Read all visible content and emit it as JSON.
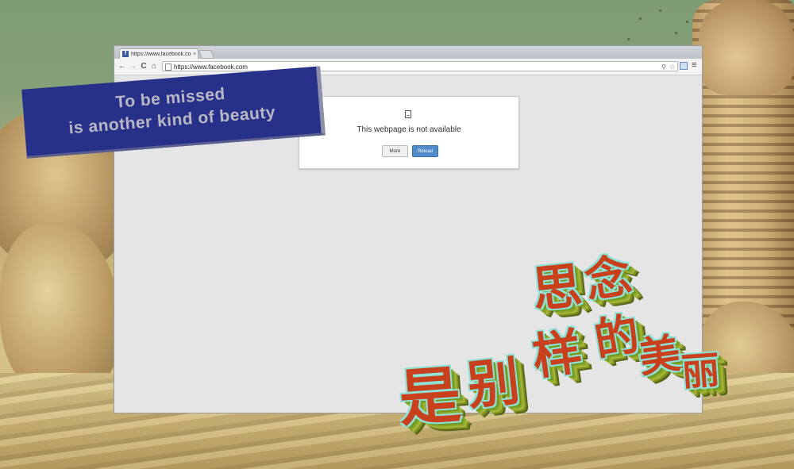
{
  "browser": {
    "tab_title": "https://www.facebook.com",
    "tab_close": "×",
    "address": "https://www.facebook.com",
    "nav": {
      "back": "←",
      "forward": "→",
      "reload": "C",
      "home": "⌂"
    },
    "menu": "≡"
  },
  "error": {
    "message": "This webpage is not available",
    "more_label": "More",
    "reload_label": "Reload"
  },
  "banner": {
    "line1": "To be missed",
    "line2": "is another kind of beauty"
  },
  "overlay_text": {
    "glyphs": [
      "思",
      "念",
      "是",
      "别",
      "样",
      "的",
      "美",
      "丽"
    ]
  },
  "colors": {
    "banner_bg": "#27318a",
    "glyph_fill": "#c8411c",
    "glyph_outline": "#8fe0d6",
    "reload_button": "#4f8cc9"
  }
}
